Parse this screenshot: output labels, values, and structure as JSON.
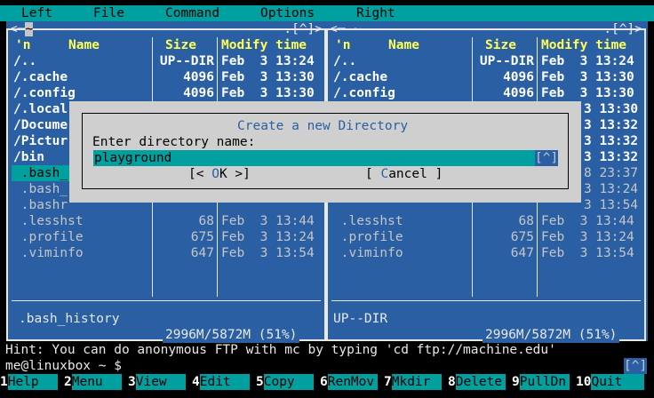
{
  "menu": [
    "Left",
    "File",
    "Command",
    "Options",
    "Right"
  ],
  "left_panel": {
    "tab": "~",
    "tab_prefix": "<─",
    "tab_suffix": ".[^]>",
    "headers": {
      "n": "'n",
      "name": "Name",
      "size": "Size",
      "mtime": "Modify time"
    },
    "rows": [
      {
        "name": "/..",
        "size": "UP--DIR",
        "date": "Feb  3 13:24",
        "style": "dir"
      },
      {
        "name": "/.cache",
        "size": "4096",
        "date": "Feb  3 13:30",
        "style": "dir"
      },
      {
        "name": "/.config",
        "size": "4096",
        "date": "Feb  3 13:30",
        "style": "dir"
      },
      {
        "name": "/.local",
        "size": "",
        "date": "",
        "style": "dir"
      },
      {
        "name": "/Docume",
        "size": "",
        "date": "",
        "style": "dir"
      },
      {
        "name": "/Pictur",
        "size": "",
        "date": "",
        "style": "dir"
      },
      {
        "name": "/bin",
        "size": "",
        "date": "",
        "style": "dir"
      },
      {
        "name": " .bash_",
        "size": "",
        "date": "",
        "style": "sel"
      },
      {
        "name": " .bash_",
        "size": "",
        "date": "",
        "style": "file"
      },
      {
        "name": " .bashr",
        "size": "",
        "date": "",
        "style": "file"
      },
      {
        "name": " .lesshst",
        "size": "68",
        "date": "Feb  3 13:44",
        "style": "file"
      },
      {
        "name": " .profile",
        "size": "675",
        "date": "Feb  3 13:24",
        "style": "file"
      },
      {
        "name": " .viminfo",
        "size": "647",
        "date": "Feb  3 13:54",
        "style": "file"
      }
    ],
    "status": " .bash_history",
    "usage": "2996M/5872M (51%)"
  },
  "right_panel": {
    "tab_prefix": "<─ ~",
    "tab_suffix": ".[^]>",
    "headers": {
      "n": "'n",
      "name": "Name",
      "size": "Size",
      "mtime": "Modify time"
    },
    "rows": [
      {
        "name": "/..",
        "size": "UP--DIR",
        "date": "Feb  3 13:24",
        "style": "dir"
      },
      {
        "name": "/.cache",
        "size": "4096",
        "date": "Feb  3 13:30",
        "style": "dir"
      },
      {
        "name": "/.config",
        "size": "4096",
        "date": "Feb  3 13:30",
        "style": "dir"
      },
      {
        "name": "",
        "size": "",
        "date": "3 13:30",
        "style": "dirtail"
      },
      {
        "name": "",
        "size": "",
        "date": "3 13:32",
        "style": "dirtail"
      },
      {
        "name": "",
        "size": "",
        "date": "3 13:32",
        "style": "dirtail"
      },
      {
        "name": "",
        "size": "",
        "date": "3 13:32",
        "style": "dirtail"
      },
      {
        "name": "",
        "size": "",
        "date": "8 23:37",
        "style": "filetail"
      },
      {
        "name": "",
        "size": "",
        "date": "3 13:24",
        "style": "filetail"
      },
      {
        "name": "",
        "size": "",
        "date": "3 13:54",
        "style": "filetail"
      },
      {
        "name": " .lesshst",
        "size": "68",
        "date": "Feb  3 13:44",
        "style": "file"
      },
      {
        "name": " .profile",
        "size": "675",
        "date": "Feb  3 13:24",
        "style": "file"
      },
      {
        "name": " .viminfo",
        "size": "647",
        "date": "Feb  3 13:54",
        "style": "file"
      }
    ],
    "status": "UP--DIR",
    "usage": "2996M/5872M (51%)"
  },
  "dialog": {
    "title": "Create a new Directory",
    "label": "Enter directory name:",
    "input_value": "playground",
    "history": "[^]",
    "ok_pre": "[< ",
    "ok_hot": "O",
    "ok_post": "K >]",
    "cancel_pre": "[ ",
    "cancel_hot": "C",
    "cancel_post": "ancel ]"
  },
  "hint": "Hint: You can do anonymous FTP with mc by typing 'cd ftp://machine.edu'",
  "prompt": "me@linuxbox ~ $",
  "cmd_history": "[^]",
  "fkeys": [
    {
      "num": "1",
      "label": "Help"
    },
    {
      "num": "2",
      "label": "Menu"
    },
    {
      "num": "3",
      "label": "View"
    },
    {
      "num": "4",
      "label": "Edit"
    },
    {
      "num": "5",
      "label": "Copy"
    },
    {
      "num": "6",
      "label": "RenMov"
    },
    {
      "num": "7",
      "label": "Mkdir"
    },
    {
      "num": "8",
      "label": "Delete"
    },
    {
      "num": "9",
      "label": "PullDn"
    },
    {
      "num": "10",
      "label": "Quit"
    }
  ]
}
